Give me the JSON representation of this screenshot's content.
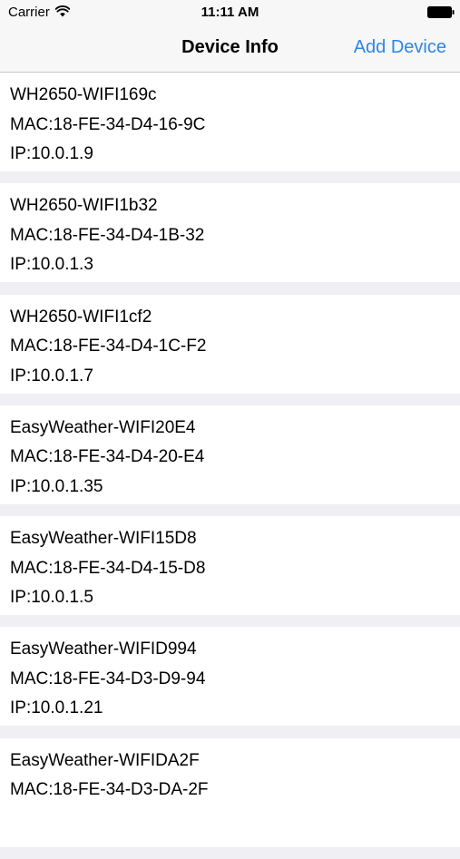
{
  "status_bar": {
    "carrier": "Carrier",
    "time": "11:11 AM",
    "wifi_icon": "wifi-icon",
    "battery_icon": "battery-full-icon"
  },
  "nav": {
    "title": "Device Info",
    "action_label": "Add Device",
    "action_color": "#2a86e8"
  },
  "colors": {
    "background": "#efeff4",
    "bar": "#f7f7f7",
    "card": "#ffffff",
    "text": "#000000"
  },
  "devices": [
    {
      "name": "WH2650-WIFI169c",
      "mac": "MAC:18-FE-34-D4-16-9C",
      "ip": "IP:10.0.1.9"
    },
    {
      "name": "WH2650-WIFI1b32",
      "mac": "MAC:18-FE-34-D4-1B-32",
      "ip": "IP:10.0.1.3"
    },
    {
      "name": "WH2650-WIFI1cf2",
      "mac": "MAC:18-FE-34-D4-1C-F2",
      "ip": "IP:10.0.1.7"
    },
    {
      "name": "EasyWeather-WIFI20E4",
      "mac": "MAC:18-FE-34-D4-20-E4",
      "ip": "IP:10.0.1.35"
    },
    {
      "name": "EasyWeather-WIFI15D8",
      "mac": "MAC:18-FE-34-D4-15-D8",
      "ip": "IP:10.0.1.5"
    },
    {
      "name": "EasyWeather-WIFID994",
      "mac": "MAC:18-FE-34-D3-D9-94",
      "ip": "IP:10.0.1.21"
    },
    {
      "name": "EasyWeather-WIFIDA2F",
      "mac": "MAC:18-FE-34-D3-DA-2F"
    }
  ]
}
